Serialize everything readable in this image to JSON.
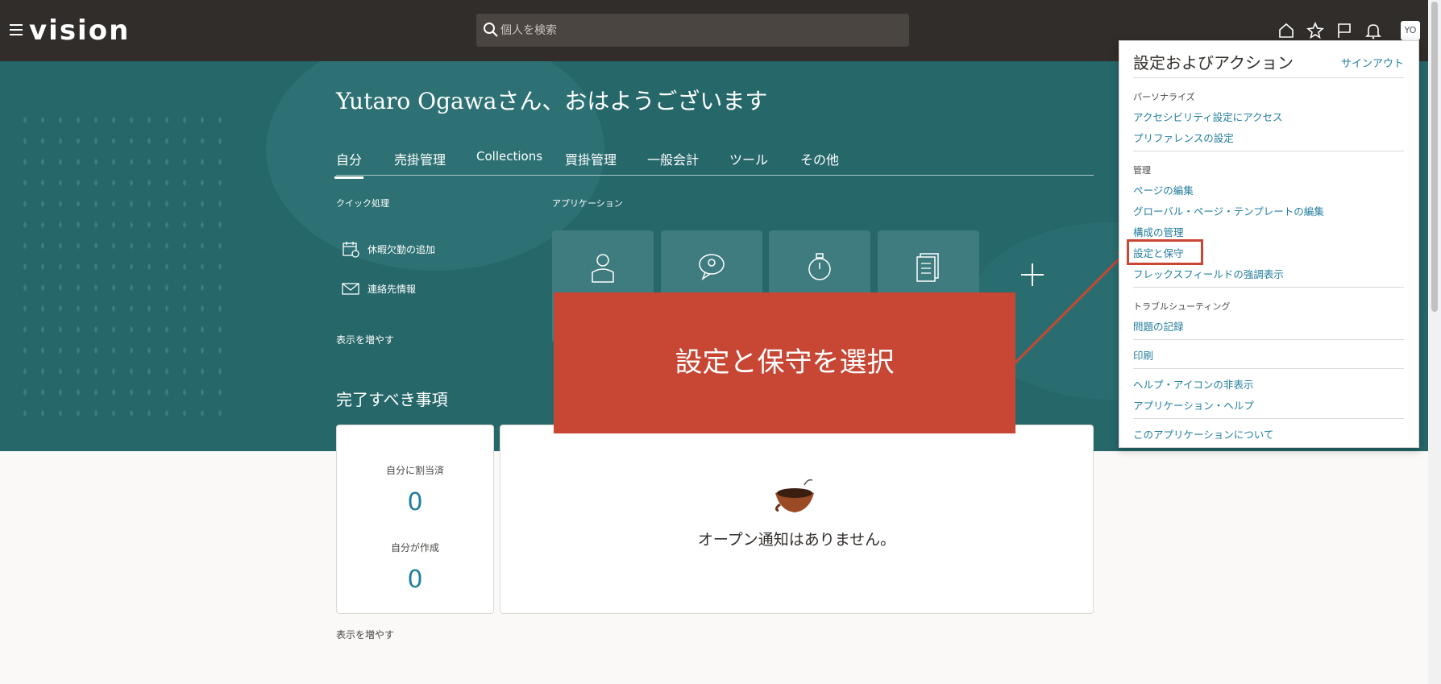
{
  "header": {
    "logo": "vision",
    "search_placeholder": "個人を検索",
    "avatar_initials": "YO"
  },
  "hero": {
    "greeting_name": "Yutaro Ogawa",
    "greeting_suffix": "さん、おはようございます",
    "tabs": [
      {
        "label": "自分"
      },
      {
        "label": "売掛管理"
      },
      {
        "label": "Collections"
      },
      {
        "label": "買掛管理"
      },
      {
        "label": "一般会計"
      },
      {
        "label": "ツール"
      },
      {
        "label": "その他"
      }
    ],
    "quick_actions_label": "クイック処理",
    "quick_actions": [
      {
        "label": "休暇欠勤の追加",
        "icon": "calendar-icon"
      },
      {
        "label": "連絡先情報",
        "icon": "envelope-icon"
      }
    ],
    "show_more": "表示を増やす",
    "applications_label": "アプリケーション"
  },
  "todo": {
    "title": "完了すべき事項",
    "assigned_label": "自分に割当済",
    "assigned_count": "0",
    "created_label": "自分が作成",
    "created_count": "0",
    "no_notifications": "オープン通知はありません。",
    "show_more": "表示を増やす"
  },
  "callout": {
    "text": "設定と保守を選択"
  },
  "settings_panel": {
    "title": "設定およびアクション",
    "signout": "サインアウト",
    "personalize_label": "パーソナライズ",
    "personalize_items": [
      "アクセシビリティ設定にアクセス",
      "プリファレンスの設定"
    ],
    "admin_label": "管理",
    "admin_items": [
      "ページの編集",
      "グローバル・ページ・テンプレートの編集",
      "構成の管理",
      "設定と保守",
      "フレックスフィールドの強調表示"
    ],
    "troubleshoot_label": "トラブルシューティング",
    "troubleshoot_items": [
      "問題の記録"
    ],
    "print": "印刷",
    "help_items": [
      "ヘルプ・アイコンの非表示",
      "アプリケーション・ヘルプ"
    ],
    "about": "このアプリケーションについて"
  },
  "colors": {
    "header_bg": "#312d2a",
    "hero_bg": "#26676a",
    "link": "#227e9e",
    "callout": "#c74634"
  }
}
